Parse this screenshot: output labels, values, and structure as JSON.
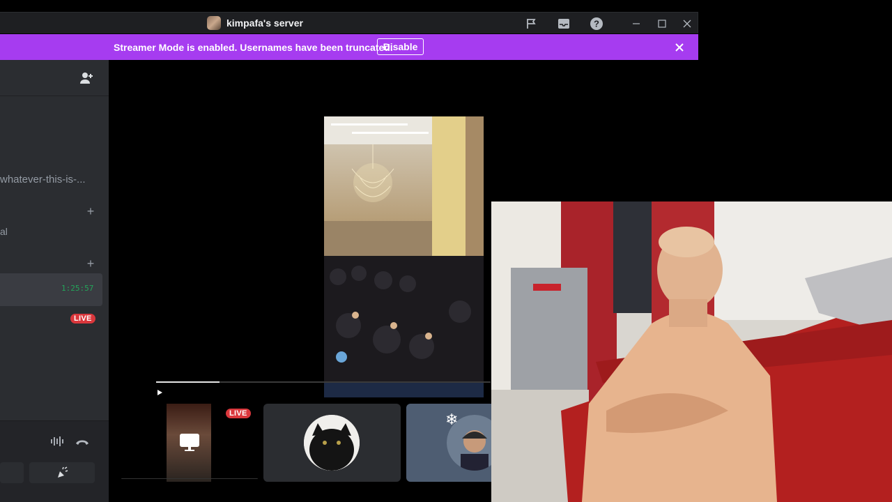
{
  "window": {
    "title": "kimpafa's server"
  },
  "banner": {
    "message": "Streamer Mode is enabled. Usernames have been truncated.",
    "button_label": "Disable"
  },
  "sidebar": {
    "channels": [
      {
        "name": "whatever-this-is-..."
      },
      {
        "name": "al"
      }
    ],
    "voice": {
      "timer": "1:25:57",
      "live_label": "LIVE"
    }
  },
  "tiles": {
    "live_label": "LIVE"
  },
  "colors": {
    "banner": "#a63cf0",
    "sidebar": "#2b2d31",
    "live": "#da373c",
    "timer": "#23a55a"
  },
  "icons": [
    "server-icon",
    "flag-icon",
    "inbox-icon",
    "help-icon",
    "minimize-icon",
    "maximize-icon",
    "close-icon",
    "add-friend-icon",
    "plus-icon",
    "soundboard-icon",
    "hangup-icon",
    "activity-icon",
    "play-icon",
    "screen-share-icon"
  ],
  "stream": {
    "progress_fraction": 0.19
  }
}
